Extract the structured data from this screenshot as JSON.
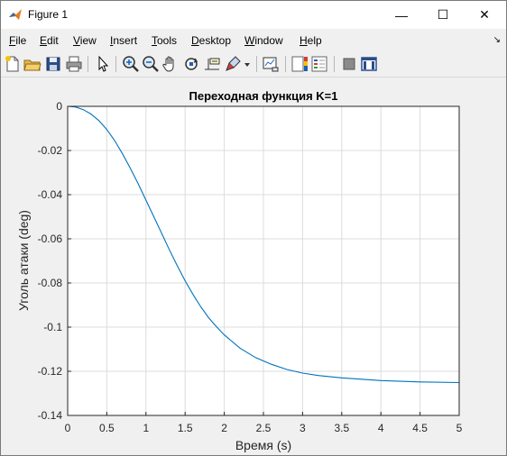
{
  "window": {
    "title": "Figure 1"
  },
  "window_controls": {
    "minimize": "—",
    "maximize": "☐",
    "close": "✕"
  },
  "menu": {
    "items": [
      {
        "label": "File",
        "key": "F",
        "rest": "ile"
      },
      {
        "label": "Edit",
        "key": "E",
        "rest": "dit"
      },
      {
        "label": "View",
        "key": "V",
        "rest": "iew"
      },
      {
        "label": "Insert",
        "key": "I",
        "rest": "nsert"
      },
      {
        "label": "Tools",
        "key": "T",
        "rest": "ools"
      },
      {
        "label": "Desktop",
        "key": "D",
        "rest": "esktop"
      },
      {
        "label": "Window",
        "key": "W",
        "rest": "indow"
      },
      {
        "label": "Help",
        "key": "H",
        "rest": "elp"
      }
    ],
    "overflow_icon": "dock-arrow-icon"
  },
  "toolbar": {
    "icons": [
      "new-figure-icon",
      "open-file-icon",
      "save-icon",
      "print-icon",
      "edit-plot-arrow-icon",
      "zoom-in-icon",
      "zoom-out-icon",
      "pan-hand-icon",
      "rotate-3d-icon",
      "data-cursor-icon",
      "brush-icon",
      "brush-dropdown-icon",
      "link-plot-icon",
      "insert-colorbar-icon",
      "insert-legend-icon",
      "hide-plot-tools-icon",
      "show-plot-tools-icon"
    ]
  },
  "colors": {
    "line": "#0072bd",
    "grid": "#dcdcdc",
    "axes": "#262626",
    "background": "#f0f0f0"
  },
  "chart_data": {
    "type": "line",
    "title": "Переходная функция K=1",
    "xlabel": "Время (s)",
    "ylabel": "Уголь атаки (deg)",
    "xlim": [
      0,
      5
    ],
    "ylim": [
      -0.14,
      0
    ],
    "xticks": [
      "0",
      "0.5",
      "1",
      "1.5",
      "2",
      "2.5",
      "3",
      "3.5",
      "4",
      "4.5",
      "5"
    ],
    "yticks": [
      "0",
      "-0.02",
      "-0.04",
      "-0.06",
      "-0.08",
      "-0.1",
      "-0.12",
      "-0.14"
    ],
    "grid": true,
    "series": [
      {
        "x": [
          0,
          0.1,
          0.2,
          0.3,
          0.4,
          0.5,
          0.6,
          0.7,
          0.8,
          0.9,
          1.0,
          1.1,
          1.2,
          1.3,
          1.4,
          1.5,
          1.6,
          1.7,
          1.8,
          1.9,
          2.0,
          2.2,
          2.4,
          2.6,
          2.8,
          3.0,
          3.2,
          3.5,
          4.0,
          4.5,
          5.0
        ],
        "y": [
          0,
          -0.0003,
          -0.0015,
          -0.0035,
          -0.0065,
          -0.0105,
          -0.0155,
          -0.0215,
          -0.028,
          -0.035,
          -0.0425,
          -0.05,
          -0.0575,
          -0.065,
          -0.0722,
          -0.079,
          -0.0852,
          -0.0908,
          -0.0957,
          -0.0998,
          -0.1035,
          -0.1095,
          -0.1138,
          -0.1168,
          -0.1192,
          -0.1208,
          -0.1219,
          -0.123,
          -0.1242,
          -0.1248,
          -0.1251
        ]
      }
    ]
  }
}
